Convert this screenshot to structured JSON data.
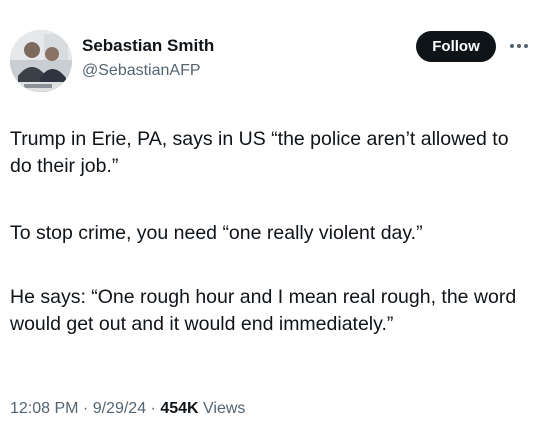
{
  "author": {
    "display_name": "Sebastian Smith",
    "handle": "@SebastianAFP",
    "avatar_icon": "profile-photo"
  },
  "follow_label": "Follow",
  "more_icon": "more-horizontal-icon",
  "body": {
    "p1": "Trump in Erie, PA, says in US “the police aren’t allowed to do their job.”",
    "p2": "To stop crime, you need “one really violent day.”",
    "p3": "He says: “One rough hour and I mean real rough, the word would get out and it would end immediately.”"
  },
  "meta": {
    "time": "12:08 PM",
    "sep1": " · ",
    "date": "9/29/24",
    "sep2": " · ",
    "views_count": "454K",
    "views_label": " Views"
  },
  "colors": {
    "text": "#0f1419",
    "secondary": "#536471",
    "button_bg": "#0f1419",
    "button_text": "#ffffff"
  }
}
